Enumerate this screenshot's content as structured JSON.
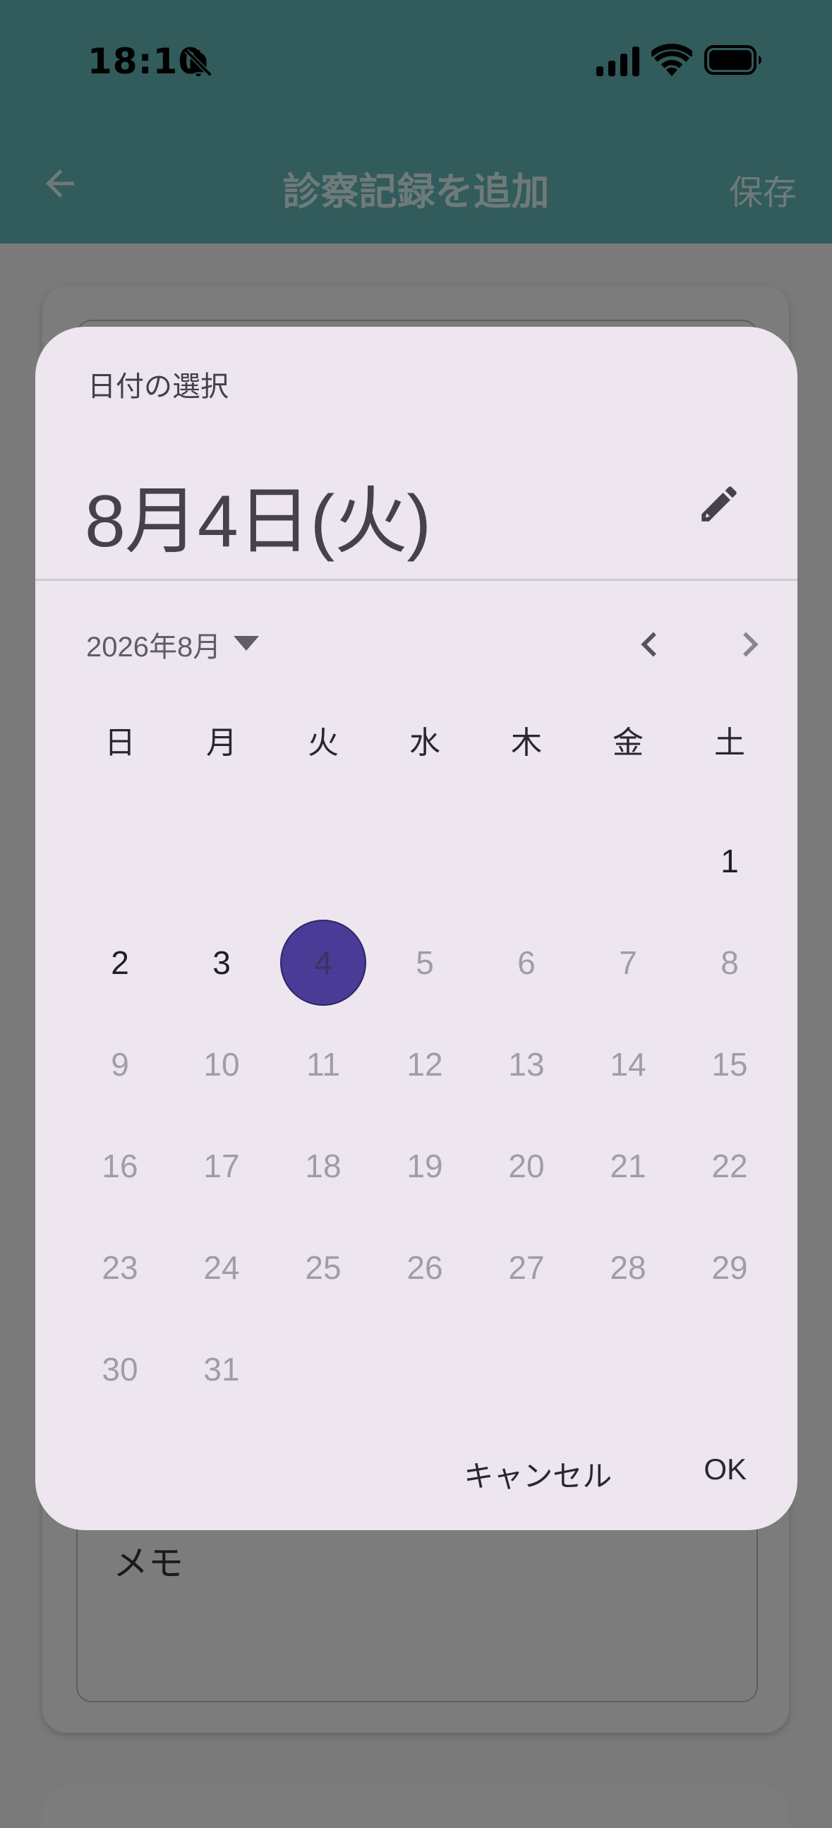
{
  "status_bar": {
    "time": "18:10"
  },
  "app_bar": {
    "title": "診察記録を追加",
    "save_label": "保存"
  },
  "form": {
    "memo_label": "メモ"
  },
  "date_picker": {
    "header_label": "日付の選択",
    "headline": "8月4日(火)",
    "month_label": "2026年8月",
    "weekdays": [
      "日",
      "月",
      "火",
      "水",
      "木",
      "金",
      "土"
    ],
    "selected_day": 4,
    "days": [
      {
        "label": "",
        "state": "empty"
      },
      {
        "label": "",
        "state": "empty"
      },
      {
        "label": "",
        "state": "empty"
      },
      {
        "label": "",
        "state": "empty"
      },
      {
        "label": "",
        "state": "empty"
      },
      {
        "label": "",
        "state": "empty"
      },
      {
        "label": "1",
        "state": "enabled"
      },
      {
        "label": "2",
        "state": "enabled"
      },
      {
        "label": "3",
        "state": "enabled"
      },
      {
        "label": "4",
        "state": "selected"
      },
      {
        "label": "5",
        "state": "disabled"
      },
      {
        "label": "6",
        "state": "disabled"
      },
      {
        "label": "7",
        "state": "disabled"
      },
      {
        "label": "8",
        "state": "disabled"
      },
      {
        "label": "9",
        "state": "disabled"
      },
      {
        "label": "10",
        "state": "disabled"
      },
      {
        "label": "11",
        "state": "disabled"
      },
      {
        "label": "12",
        "state": "disabled"
      },
      {
        "label": "13",
        "state": "disabled"
      },
      {
        "label": "14",
        "state": "disabled"
      },
      {
        "label": "15",
        "state": "disabled"
      },
      {
        "label": "16",
        "state": "disabled"
      },
      {
        "label": "17",
        "state": "disabled"
      },
      {
        "label": "18",
        "state": "disabled"
      },
      {
        "label": "19",
        "state": "disabled"
      },
      {
        "label": "20",
        "state": "disabled"
      },
      {
        "label": "21",
        "state": "disabled"
      },
      {
        "label": "22",
        "state": "disabled"
      },
      {
        "label": "23",
        "state": "disabled"
      },
      {
        "label": "24",
        "state": "disabled"
      },
      {
        "label": "25",
        "state": "disabled"
      },
      {
        "label": "26",
        "state": "disabled"
      },
      {
        "label": "27",
        "state": "disabled"
      },
      {
        "label": "28",
        "state": "disabled"
      },
      {
        "label": "29",
        "state": "disabled"
      },
      {
        "label": "30",
        "state": "disabled"
      },
      {
        "label": "31",
        "state": "disabled"
      }
    ],
    "cancel_label": "キャンセル",
    "ok_label": "OK"
  },
  "icons": {
    "bell": "bell-off-icon",
    "signal": "cellular-signal-icon",
    "wifi": "wifi-icon",
    "battery": "battery-icon",
    "back": "arrow-back-icon",
    "edit": "pencil-icon",
    "dropdown": "dropdown-triangle-icon",
    "prev": "chevron-left-icon",
    "next": "chevron-right-icon"
  },
  "colors": {
    "app_bar": "#325b5b",
    "dialog_bg": "#ede6ee",
    "selected_day": "#4a3b96",
    "scrim": "#7a7a7a"
  }
}
